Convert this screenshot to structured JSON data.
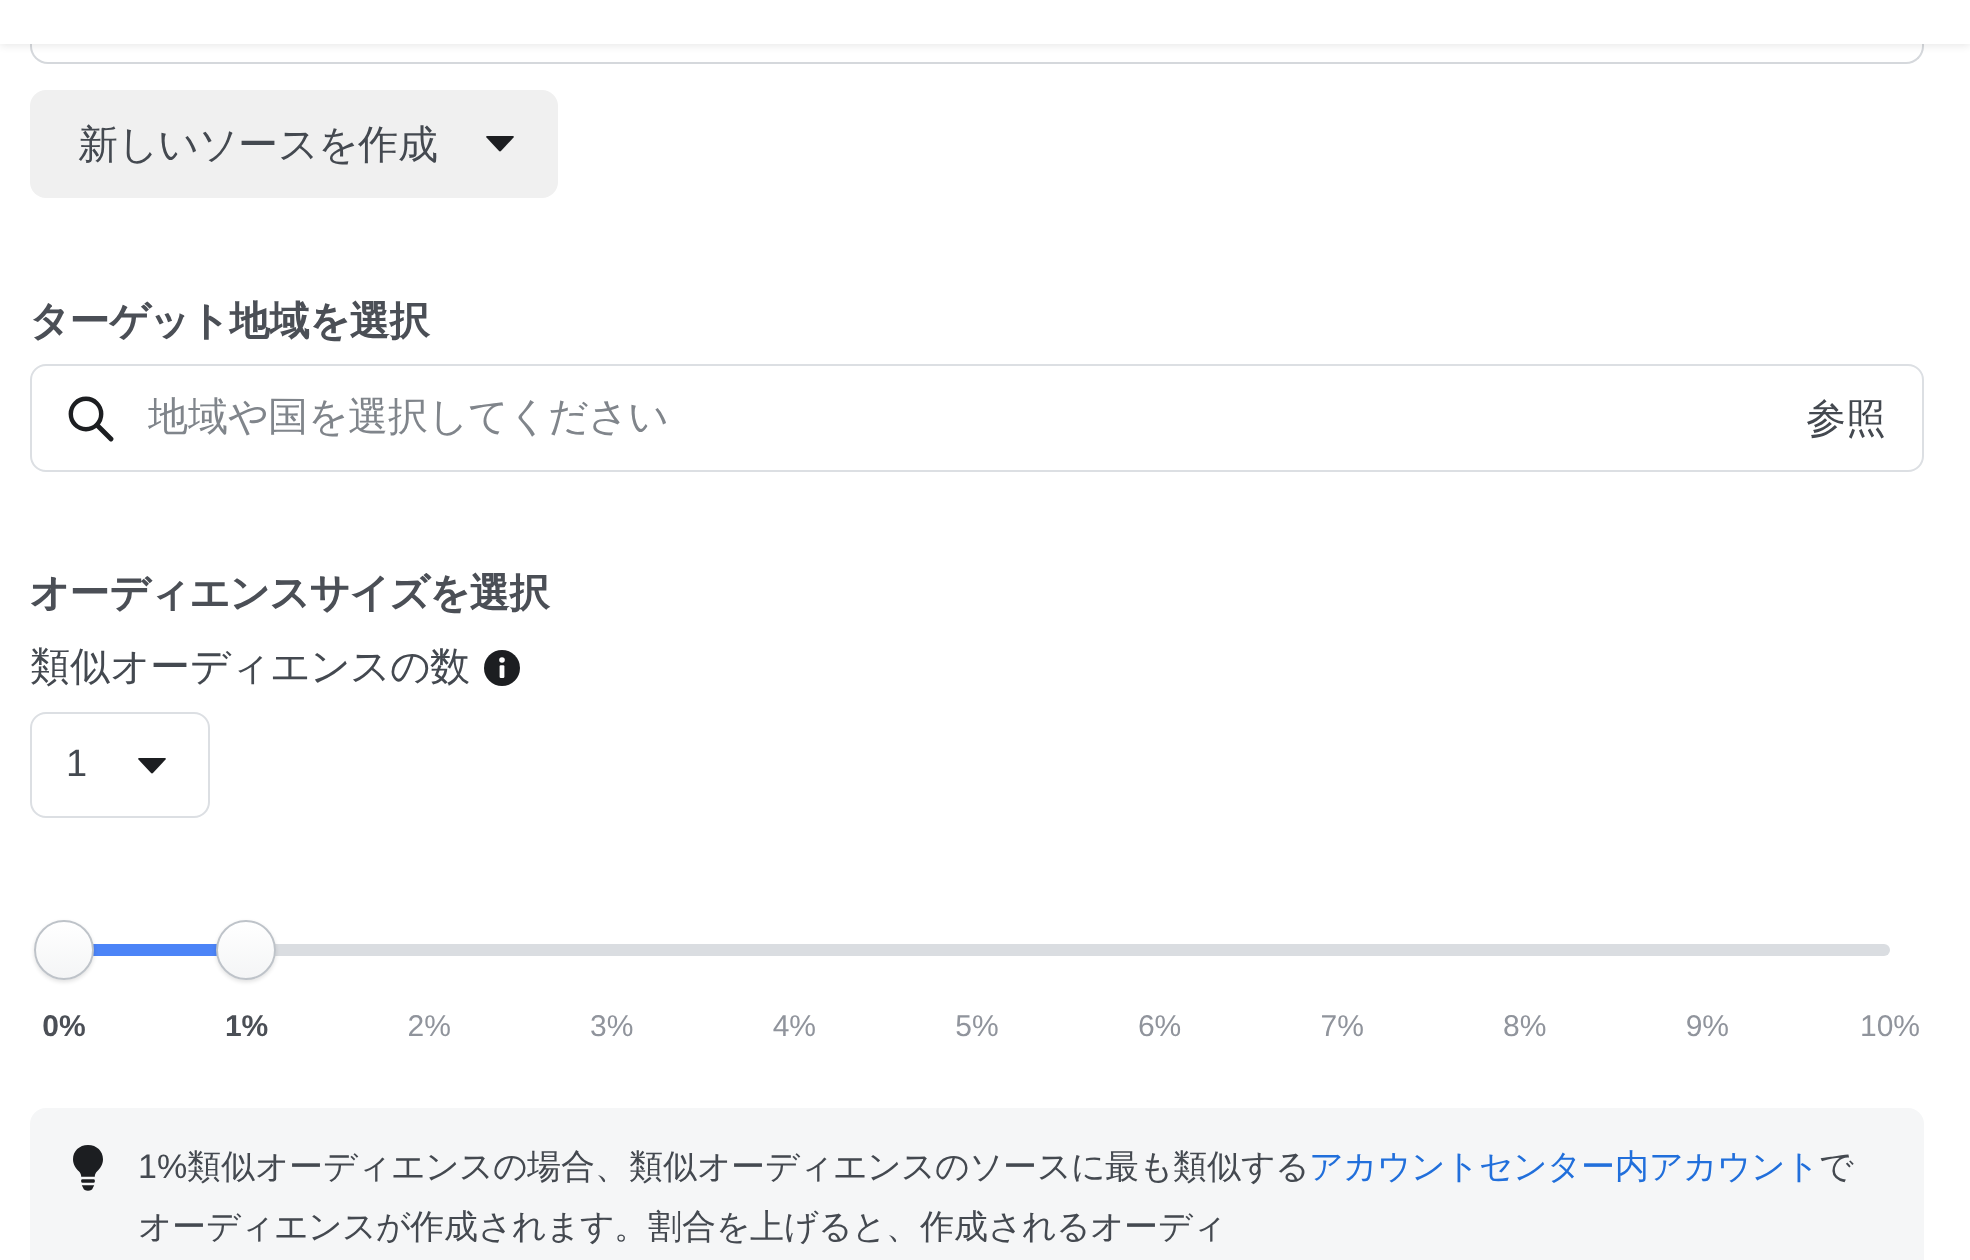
{
  "create_source_button": {
    "label": "新しいソースを作成"
  },
  "target_region": {
    "heading": "ターゲット地域を選択",
    "search": {
      "placeholder": "地域や国を選択してください",
      "browse_label": "参照"
    }
  },
  "audience_size": {
    "heading": "オーディエンスサイズを選択",
    "count_label": "類似オーディエンスの数",
    "count_select": {
      "value": "1"
    },
    "slider": {
      "thumbs": [
        {
          "level": 0
        },
        {
          "level": 0.1
        }
      ],
      "ticks": [
        {
          "label": "0%",
          "selected": true
        },
        {
          "label": "1%",
          "selected": true
        },
        {
          "label": "2%",
          "selected": false
        },
        {
          "label": "3%",
          "selected": false
        },
        {
          "label": "4%",
          "selected": false
        },
        {
          "label": "5%",
          "selected": false
        },
        {
          "label": "6%",
          "selected": false
        },
        {
          "label": "7%",
          "selected": false
        },
        {
          "label": "8%",
          "selected": false
        },
        {
          "label": "9%",
          "selected": false
        },
        {
          "label": "10%",
          "selected": false
        }
      ]
    }
  },
  "info": {
    "text_before": "1%類似オーディエンスの場合、類似オーディエンスのソースに最も類似する",
    "link": "アカウントセンター内アカウント",
    "text_after": "でオーディエンスが作成されます。割合を上げると、作成されるオーディ"
  }
}
